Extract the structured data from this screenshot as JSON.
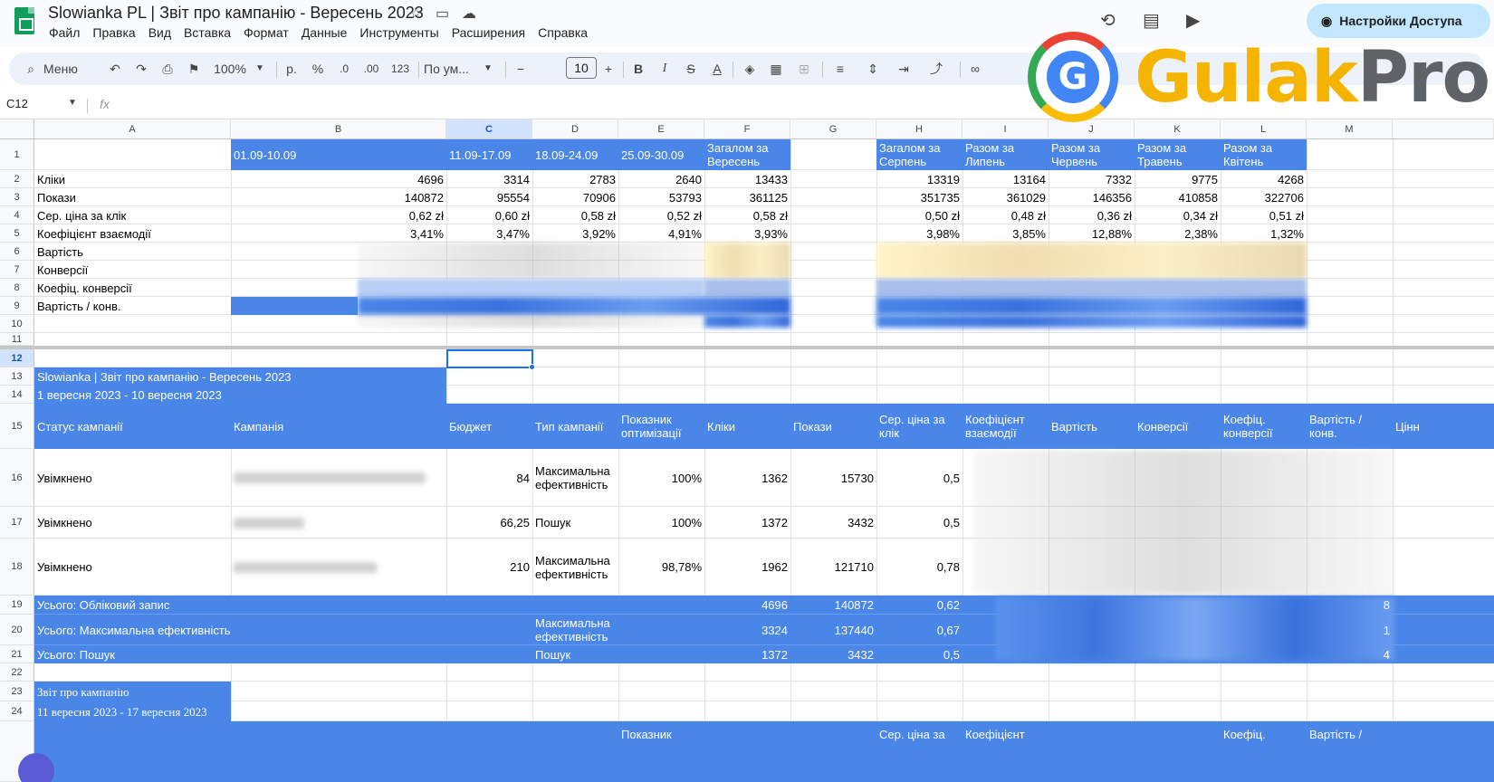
{
  "titlebar": {
    "doc_title": "Slowianka PL | Звіт про кампанію - Вересень 2023",
    "share_label": "Настройки Доступа",
    "menu": [
      "Файл",
      "Правка",
      "Вид",
      "Вставка",
      "Формат",
      "Данные",
      "Инструменты",
      "Расширения",
      "Справка"
    ]
  },
  "toolbar": {
    "menu_label": "Меню",
    "zoom": "100%",
    "currency": "р.",
    "percent": "%",
    "dec_minus": ".0",
    "dec_plus": ".00",
    "format_123": "123",
    "font_name": "По ум...",
    "font_size": "10",
    "bold": "B",
    "italic": "I",
    "strike": "S",
    "text_color": "A"
  },
  "formula_bar": {
    "cell_ref": "C12",
    "fx": "fx"
  },
  "watermark": {
    "text_g": "G",
    "text_ulak": "ulak",
    "text_pro": "Pro"
  },
  "grid": {
    "columns": [
      "A",
      "B",
      "C",
      "D",
      "E",
      "F",
      "G",
      "H",
      "I",
      "J",
      "K",
      "L",
      "M"
    ],
    "rows": [
      "1",
      "2",
      "3",
      "4",
      "5",
      "6",
      "7",
      "8",
      "9",
      "10",
      "11",
      "12",
      "13",
      "14",
      "15",
      "16",
      "17",
      "18",
      "19",
      "20",
      "21",
      "22",
      "23",
      "24"
    ],
    "top_table": {
      "headers": [
        "01.09-10.09",
        "11.09-17.09",
        "18.09-24.09",
        "25.09-30.09",
        "Загалом за Вересень",
        "Загалом за Серпень",
        "Разом за Липень",
        "Разом за Червень",
        "Разом за Травень",
        "Разом за Квітень"
      ],
      "labels": [
        "Кліки",
        "Покази",
        "Сер. ціна за клік",
        "Коефіцієнт взаємодії",
        "Вартість",
        "Конверсії",
        "Коефіц. конверсії",
        "Вартість / конв."
      ],
      "data": [
        [
          "4696",
          "3314",
          "2783",
          "2640",
          "13433",
          "13319",
          "13164",
          "7332",
          "9775",
          "4268"
        ],
        [
          "140872",
          "95554",
          "70906",
          "53793",
          "361125",
          "351735",
          "361029",
          "146356",
          "410858",
          "322706"
        ],
        [
          "0,62 zł",
          "0,60 zł",
          "0,58 zł",
          "0,52 zł",
          "0,58 zł",
          "0,50 zł",
          "0,48 zł",
          "0,36 zł",
          "0,34 zł",
          "0,51 zł"
        ],
        [
          "3,41%",
          "3,47%",
          "3,92%",
          "4,91%",
          "3,93%",
          "3,98%",
          "3,85%",
          "12,88%",
          "2,38%",
          "1,32%"
        ]
      ]
    },
    "report1": {
      "title": "Slowianka | Звіт про кампанію - Вересень 2023",
      "period": "1 вересня 2023 - 10 вересня 2023",
      "headers": [
        "Статус кампанії",
        "Кампанія",
        "Бюджет",
        "Тип кампанії",
        "Показник оптимізації",
        "Кліки",
        "Покази",
        "Сер. ціна за клік",
        "Коефіцієнт взаємодії",
        "Вартість",
        "Конверсії",
        "Коефіц. конверсії",
        "Вартість / конв.",
        "Цінн"
      ],
      "rows": [
        {
          "status": "Увімкнено",
          "budget": "84",
          "type": "Максимальна ефективність",
          "opt": "100%",
          "clicks": "1362",
          "impr": "15730",
          "cpc": "0,5"
        },
        {
          "status": "Увімкнено",
          "budget": "66,25",
          "type": "Пошук",
          "opt": "100%",
          "clicks": "1372",
          "impr": "3432",
          "cpc": "0,5"
        },
        {
          "status": "Увімкнено",
          "budget": "210",
          "type": "Максимальна ефективність",
          "opt": "98,78%",
          "clicks": "1962",
          "impr": "121710",
          "cpc": "0,78"
        }
      ],
      "totals": [
        {
          "label": "Усього: Обліковий запис",
          "type": "",
          "clicks": "4696",
          "impr": "140872",
          "cpc": "0,62",
          "tail": "8"
        },
        {
          "label": "Усього: Максимальна ефективність",
          "type": "Максимальна ефективність",
          "clicks": "3324",
          "impr": "137440",
          "cpc": "0,67",
          "tail": "1"
        },
        {
          "label": "Усього: Пошук",
          "type": "Пошук",
          "clicks": "1372",
          "impr": "3432",
          "cpc": "0,5",
          "tail": "4"
        }
      ]
    },
    "report2": {
      "title": "Звіт про кампанію",
      "period": "11 вересня 2023 - 17 вересня 2023",
      "headers_partial": [
        "Показник",
        "Сер. ціна за",
        "Коефіцієнт",
        "Коефіц.",
        "Вартість /"
      ]
    }
  },
  "colors": {
    "header_blue": "#4a86e8",
    "select_blue": "#1a73e8",
    "sheets_green": "#0f9d58"
  }
}
